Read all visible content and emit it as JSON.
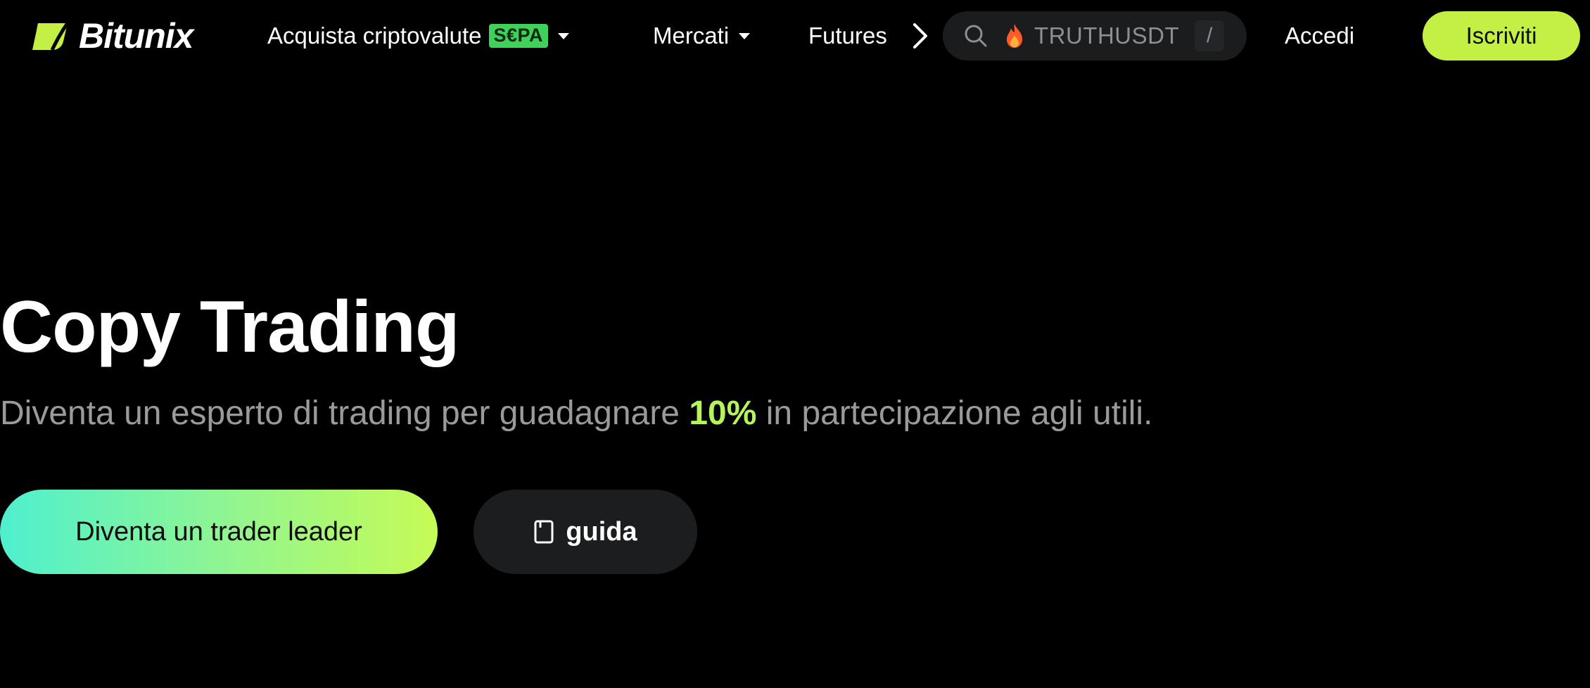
{
  "header": {
    "logo_text": "Bitunix",
    "nav": {
      "buy_crypto": "Acquista criptovalute",
      "sepa_badge": "S€PA",
      "markets": "Mercati",
      "futures": "Futures"
    },
    "search": {
      "value": "TRUTHUSDT",
      "shortcut": "/"
    },
    "login_label": "Accedi",
    "signup_label": "Iscriviti"
  },
  "hero": {
    "title": "Copy Trading",
    "subtitle_before": "Diventa un esperto di trading per guadagnare ",
    "subtitle_highlight": "10%",
    "subtitle_after": " in partecipazione agli utili.",
    "primary_button_label": "Diventa un trader leader",
    "guide_button_label": "guida"
  },
  "icons": {
    "logo": "bitunix-logo-icon",
    "search": "search-icon",
    "hot": "fire-icon",
    "guide": "book-icon",
    "more": "chevron-right-icon",
    "dropdown": "caret-down-icon"
  },
  "colors": {
    "background": "#000000",
    "brand_accent": "#c4f046",
    "highlight": "#b6f35c",
    "sepa_badge": "#3fd15a",
    "gradient_start": "#4ef0cf",
    "gradient_end": "#c6fb55",
    "search_bg": "#1b1c1e",
    "muted_text": "#9a9a9a"
  }
}
